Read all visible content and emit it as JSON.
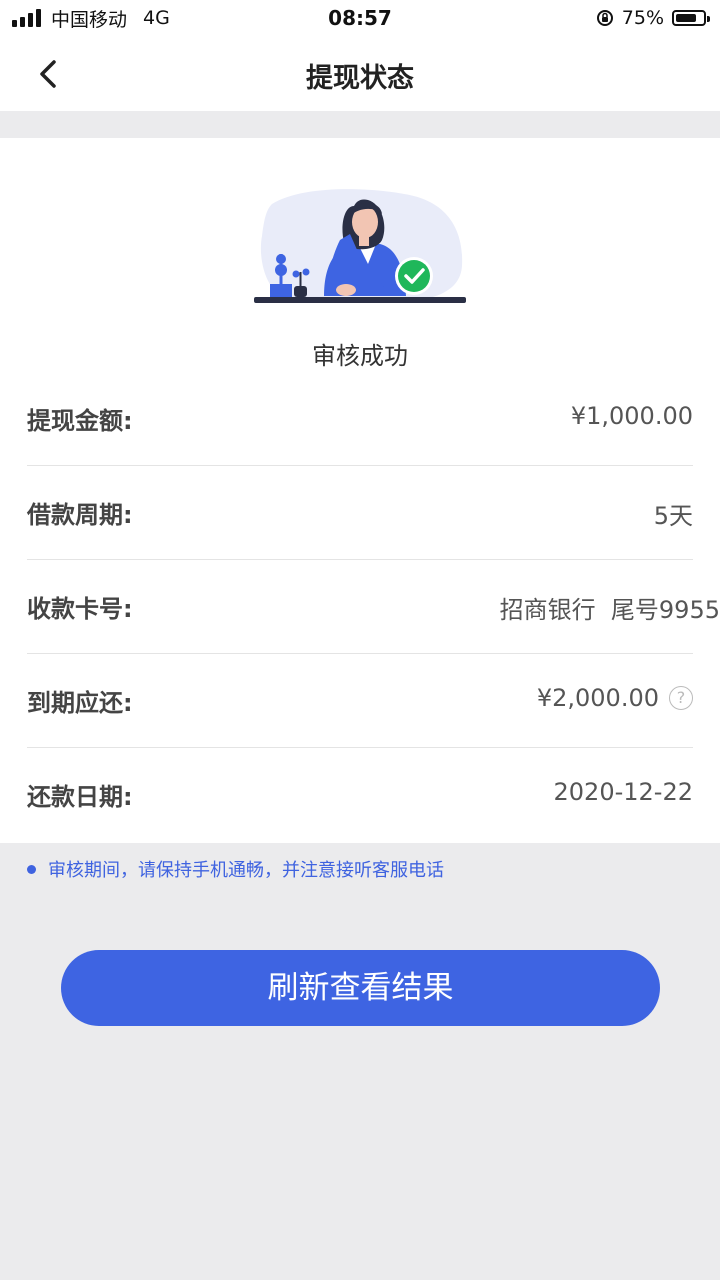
{
  "statusbar": {
    "carrier": "中国移动",
    "network": "4G",
    "time": "08:57",
    "battery_percent": "75%",
    "battery_level": 0.75
  },
  "navbar": {
    "title": "提现状态",
    "back_icon": "chevron-left-icon"
  },
  "result": {
    "status": "审核成功",
    "illustration": "woman-at-desk-success-icon",
    "check_color": "#1fb75a"
  },
  "details": [
    {
      "label": "提现金额:",
      "value": "¥1,000.00"
    },
    {
      "label": "借款周期:",
      "value": "5天"
    },
    {
      "label": "收款卡号:",
      "value": "招商银行  尾号9955"
    },
    {
      "label": "到期应还:",
      "value": "¥2,000.00",
      "icon": "question-circle-icon"
    },
    {
      "label": "还款日期:",
      "value": "2020-12-22"
    }
  ],
  "notice": "审核期间，请保持手机通畅，并注意接听客服电话",
  "primary_button": "刷新查看结果",
  "colors": {
    "accent": "#3e64e2",
    "background": "#ebebed"
  }
}
